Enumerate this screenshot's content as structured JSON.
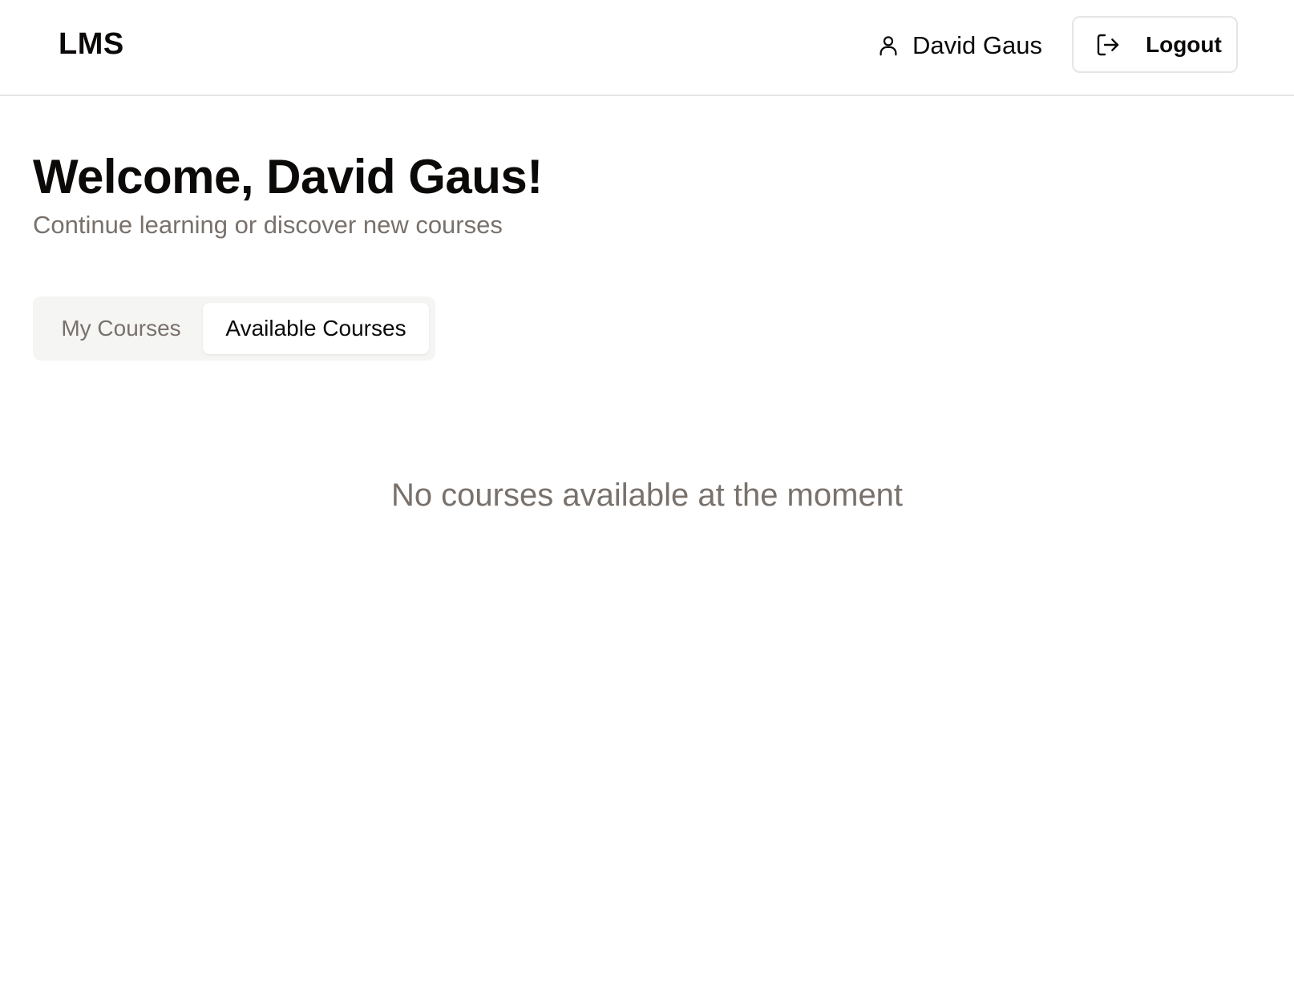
{
  "header": {
    "logo": "LMS",
    "user_name": "David Gaus",
    "user_icon": "user-icon",
    "logout_label": "Logout",
    "logout_icon": "logout-icon"
  },
  "main": {
    "title": "Welcome, David Gaus!",
    "subtitle": "Continue learning or discover new courses",
    "tabs": [
      {
        "label": "My Courses",
        "active": false
      },
      {
        "label": "Available Courses",
        "active": true
      }
    ],
    "empty_message": "No courses available at the moment"
  },
  "colors": {
    "text": "#0c0a09",
    "muted": "#78716c",
    "border": "#e7e5e4",
    "tab_background": "#f5f5f4"
  }
}
